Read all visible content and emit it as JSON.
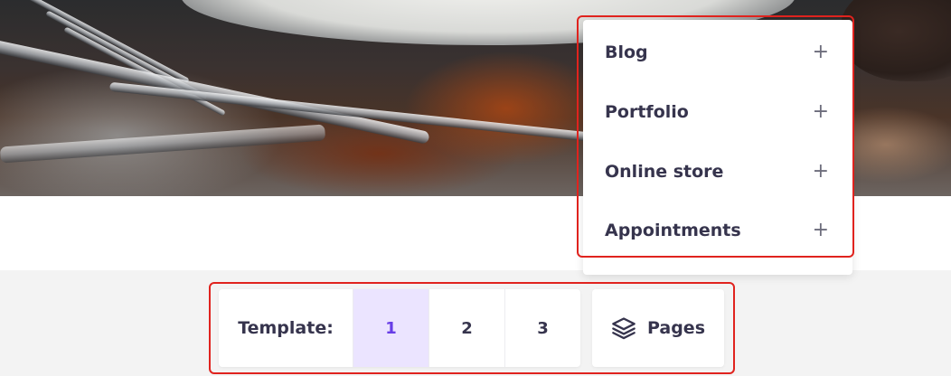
{
  "menu": {
    "items": [
      {
        "label": "Blog",
        "icon": "plus-icon"
      },
      {
        "label": "Portfolio",
        "icon": "plus-icon"
      },
      {
        "label": "Online store",
        "icon": "plus-icon"
      },
      {
        "label": "Appointments",
        "icon": "plus-icon"
      }
    ],
    "plus_glyph": "+"
  },
  "template_bar": {
    "label": "Template:",
    "options": [
      "1",
      "2",
      "3"
    ],
    "active": "1",
    "pages_label": "Pages",
    "pages_icon": "layers-icon"
  },
  "colors": {
    "accent": "#673de6",
    "active_bg": "#ebe4ff",
    "text": "#36344d",
    "highlight_border": "#e0231e"
  }
}
